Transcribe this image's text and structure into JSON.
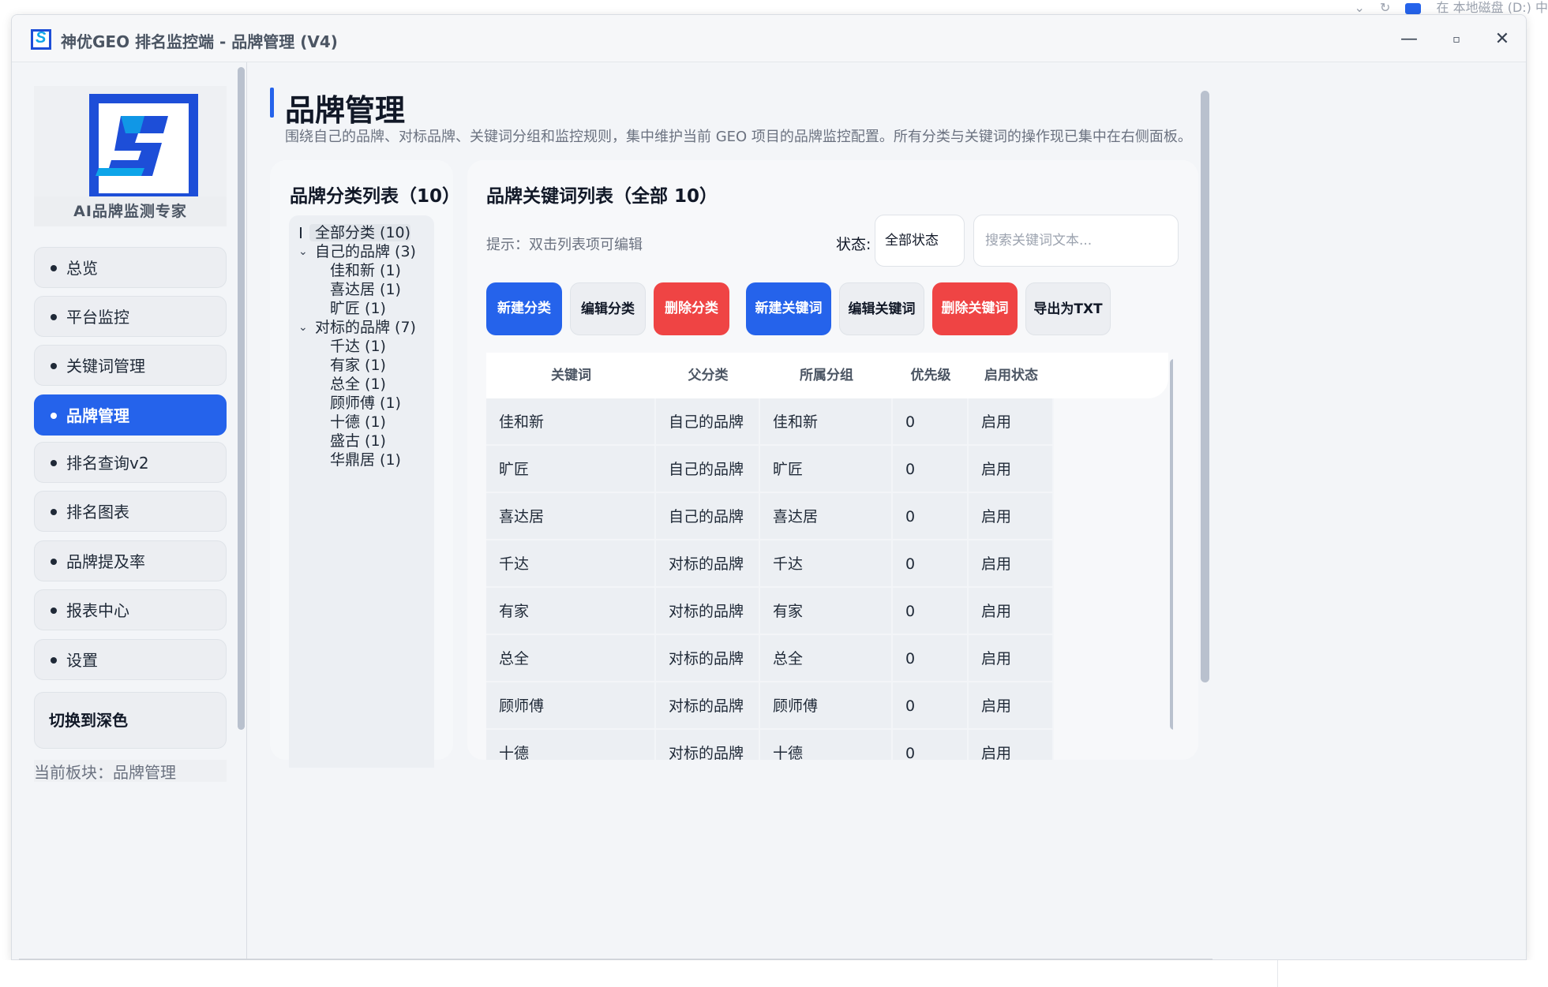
{
  "os": {
    "background_text": "在 本地磁盘 (D:) 中"
  },
  "window": {
    "title": "神优GEO 排名监控端 - 品牌管理 (V4)",
    "controls": {
      "minimize": "—",
      "maximize": "▫",
      "close": "✕"
    }
  },
  "sidebar": {
    "tagline": "AI品牌监测专家",
    "items": [
      {
        "label": "总览",
        "active": false
      },
      {
        "label": "平台监控",
        "active": false
      },
      {
        "label": "关键词管理",
        "active": false
      },
      {
        "label": "品牌管理",
        "active": true
      },
      {
        "label": "排名查询v2",
        "active": false
      },
      {
        "label": "排名图表",
        "active": false
      },
      {
        "label": "品牌提及率",
        "active": false
      },
      {
        "label": "报表中心",
        "active": false
      },
      {
        "label": "设置",
        "active": false
      }
    ],
    "theme_button": "切换到深色",
    "current_module": "当前板块：品牌管理"
  },
  "page": {
    "title": "品牌管理",
    "description": "围绕自己的品牌、对标品牌、关键词分组和监控规则，集中维护当前 GEO 项目的品牌监控配置。所有分类与关键词的操作现已集中在右侧面板。"
  },
  "category_panel": {
    "title": "品牌分类列表（10）",
    "tree": [
      {
        "label": "全部分类 (10)",
        "level": 0,
        "selected": true
      },
      {
        "label": "自己的品牌 (3)",
        "level": 0,
        "expanded": true
      },
      {
        "label": "佳和新 (1)",
        "level": 1
      },
      {
        "label": "喜达居 (1)",
        "level": 1
      },
      {
        "label": "旷匠 (1)",
        "level": 1
      },
      {
        "label": "对标的品牌 (7)",
        "level": 0,
        "expanded": true
      },
      {
        "label": "千达 (1)",
        "level": 1
      },
      {
        "label": "有家 (1)",
        "level": 1
      },
      {
        "label": "总全 (1)",
        "level": 1
      },
      {
        "label": "顾师傅 (1)",
        "level": 1
      },
      {
        "label": "十德 (1)",
        "level": 1
      },
      {
        "label": "盛古 (1)",
        "level": 1
      },
      {
        "label": "华鼎居 (1)",
        "level": 1
      }
    ]
  },
  "keyword_panel": {
    "title": "品牌关键词列表（全部 10）",
    "hint": "提示：双击列表项可编辑",
    "status_label": "状态:",
    "status_value": "全部状态",
    "search_placeholder": "搜索关键词文本...",
    "buttons": {
      "new_category": "新建分类",
      "edit_category": "编辑分类",
      "delete_category": "删除分类",
      "new_keyword": "新建关键词",
      "edit_keyword": "编辑关键词",
      "delete_keyword": "删除关键词",
      "export_txt": "导出为TXT"
    },
    "columns": [
      "关键词",
      "父分类",
      "所属分组",
      "优先级",
      "启用状态"
    ],
    "rows": [
      [
        "佳和新",
        "自己的品牌",
        "佳和新",
        "0",
        "启用"
      ],
      [
        "旷匠",
        "自己的品牌",
        "旷匠",
        "0",
        "启用"
      ],
      [
        "喜达居",
        "自己的品牌",
        "喜达居",
        "0",
        "启用"
      ],
      [
        "千达",
        "对标的品牌",
        "千达",
        "0",
        "启用"
      ],
      [
        "有家",
        "对标的品牌",
        "有家",
        "0",
        "启用"
      ],
      [
        "总全",
        "对标的品牌",
        "总全",
        "0",
        "启用"
      ],
      [
        "顾师傅",
        "对标的品牌",
        "顾师傅",
        "0",
        "启用"
      ],
      [
        "十德",
        "对标的品牌",
        "十德",
        "0",
        "启用"
      ]
    ]
  },
  "colors": {
    "accent": "#2563eb",
    "danger": "#ef4444",
    "logo_blue": "#1d4ed8",
    "logo_cyan": "#0ea5e9"
  }
}
